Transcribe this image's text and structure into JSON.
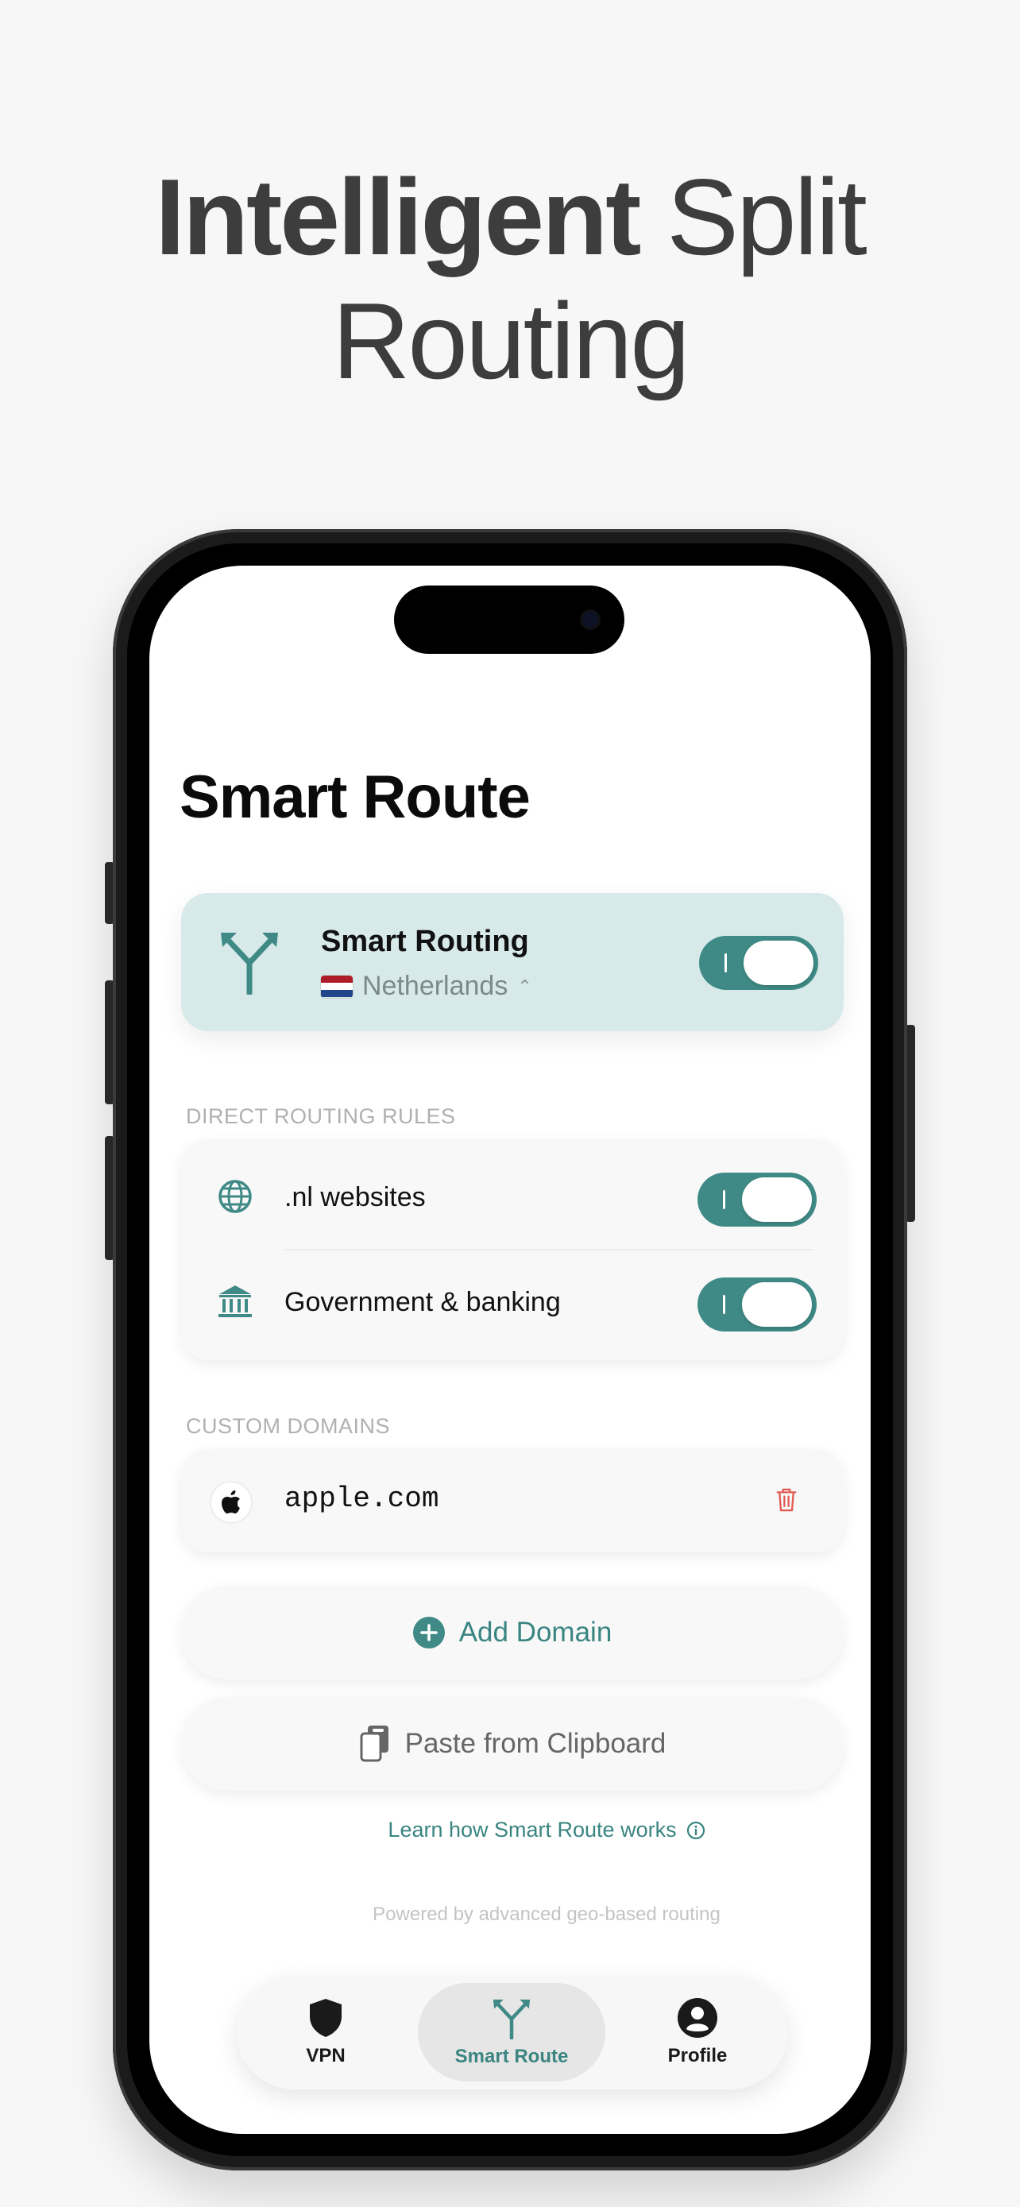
{
  "headline": {
    "bold": "Intelligent",
    "light_line1": "Split",
    "light_line2": "Routing"
  },
  "screen": {
    "title": "Smart Route",
    "smart_routing": {
      "title": "Smart Routing",
      "country": "Netherlands",
      "enabled": true,
      "icon": "split-route-icon"
    },
    "direct_rules": {
      "header": "DIRECT ROUTING RULES",
      "items": [
        {
          "label": ".nl websites",
          "icon": "globe-icon",
          "enabled": true
        },
        {
          "label": "Government & banking",
          "icon": "bank-icon",
          "enabled": true
        }
      ]
    },
    "custom_domains": {
      "header": "CUSTOM DOMAINS",
      "items": [
        {
          "domain": "apple.com",
          "icon": "apple-icon",
          "action_icon": "trash-icon"
        }
      ]
    },
    "add_domain_label": "Add Domain",
    "paste_label": "Paste from Clipboard",
    "learn_link": "Learn how Smart Route works",
    "powered_by": "Powered by advanced geo-based routing",
    "tabs": [
      {
        "label": "VPN",
        "icon": "shield-icon",
        "active": false
      },
      {
        "label": "Smart Route",
        "icon": "split-route-icon",
        "active": true
      },
      {
        "label": "Profile",
        "icon": "person-icon",
        "active": false
      }
    ]
  },
  "colors": {
    "accent": "#3f8a86",
    "card_tint": "#d7e9e8",
    "delete": "#e05a52",
    "background": "#f7f7f7"
  }
}
